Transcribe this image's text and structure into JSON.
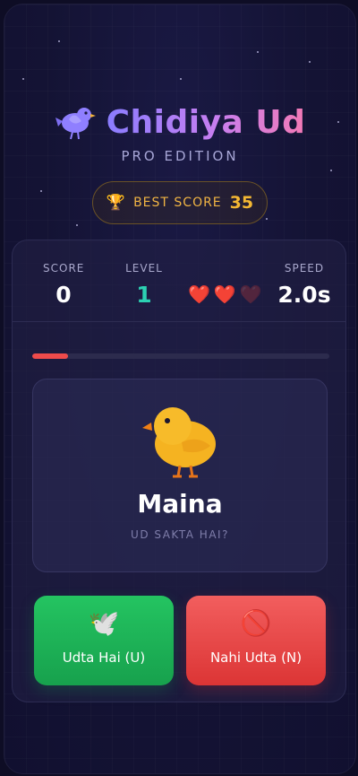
{
  "app": {
    "title": "Chidiya Ud",
    "subtitle": "PRO EDITION",
    "logo_icon": "bird-icon"
  },
  "best_score": {
    "icon": "trophy-icon",
    "label": "BEST SCORE",
    "value": "35"
  },
  "stats": {
    "score": {
      "label": "SCORE",
      "value": "0"
    },
    "level": {
      "label": "LEVEL",
      "value": "1"
    },
    "lives": {
      "current": 2,
      "max": 3,
      "icon": "heart-icon"
    },
    "speed": {
      "label": "SPEED",
      "value": "2.0s"
    }
  },
  "timer": {
    "progress": 0.12,
    "color": "#ee4b4b"
  },
  "question_card": {
    "icon": "chick-icon",
    "name": "Maina",
    "prompt": "UD SAKTA HAI?"
  },
  "buttons": {
    "yes": {
      "label": "Udta Hai (U)",
      "icon": "dove-icon",
      "color": "#1fb558"
    },
    "no": {
      "label": "Nahi Udta (N)",
      "icon": "prohibited-icon",
      "color": "#e84646"
    }
  },
  "colors": {
    "accent_purple": "#8a7dff",
    "accent_pink": "#f27ab6",
    "gold": "#f4b833",
    "teal": "#2cd1b3"
  }
}
